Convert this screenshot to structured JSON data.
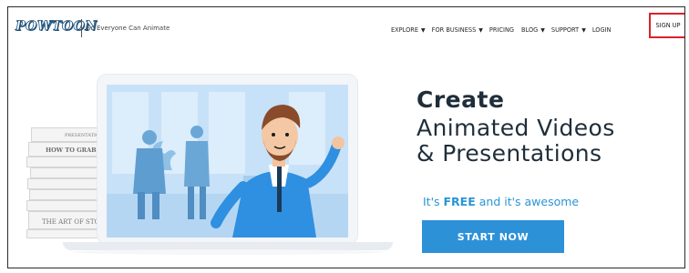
{
  "header": {
    "logo_text": "POWTOON",
    "tagline": "So Everyone Can Animate",
    "nav": {
      "explore": "EXPLORE",
      "for_business": "FOR BUSINESS",
      "pricing": "PRICING",
      "blog": "BLOG",
      "support": "SUPPORT",
      "login": "LOGIN",
      "signup": "SIGN UP"
    },
    "caret_glyph": "▼"
  },
  "books": {
    "presentation": "PRESENTATION",
    "how_to": "HOW TO GRAB A",
    "art_of_story": "THE ART OF STORY"
  },
  "hero": {
    "title_bold": "Create",
    "title_line1": "Animated Videos",
    "title_line2": "& Presentations",
    "sub_prefix": "It's ",
    "sub_bold": "FREE",
    "sub_suffix": " and it's awesome",
    "cta": "START NOW"
  },
  "colors": {
    "accent": "#2d91d8",
    "highlight_box": "#d9232b",
    "heading": "#1f2e3a",
    "subtext": "#2a95d6"
  }
}
